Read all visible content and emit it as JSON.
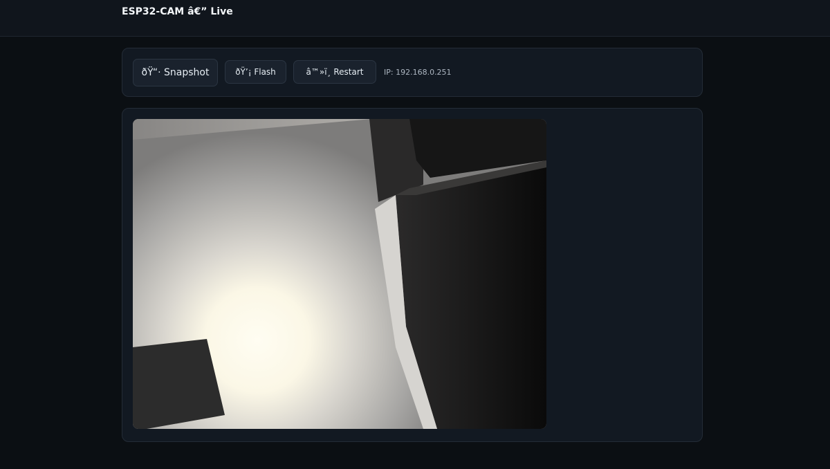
{
  "header": {
    "title": "ESP32-CAM â€” Live"
  },
  "toolbar": {
    "snapshot_label": "ðŸ“· Snapshot",
    "flash_label": "ðŸ’¡ Flash",
    "restart_label": "â™»ï¸ Restart",
    "ip_text": "IP: 192.168.0.251"
  },
  "stream": {
    "content": "camera-feed"
  }
}
